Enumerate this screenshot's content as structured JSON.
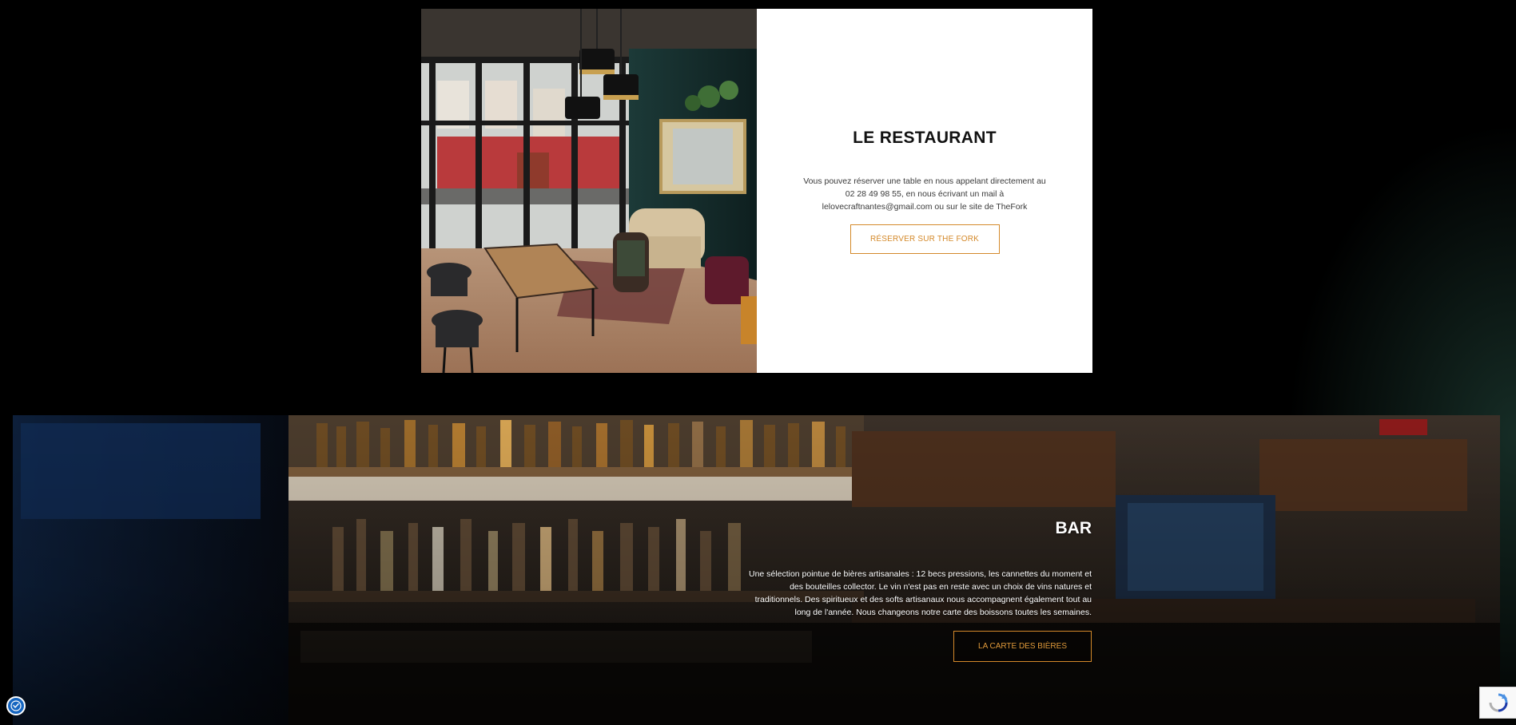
{
  "restaurant": {
    "title": "LE RESTAURANT",
    "description": "Vous pouvez réserver une table en nous appelant directement au 02 28 49 98 55, en nous écrivant un mail à lelovecraftnantes@gmail.com ou sur le site de TheFork",
    "button_label": "RÉSERVER SUR THE FORK"
  },
  "bar": {
    "title": "BAR",
    "description": "Une sélection pointue de bières artisanales : 12 becs pressions, les cannettes du moment et des bouteilles collector. Le vin n'est pas en reste avec un choix de vins natures et traditionnels. Des spiritueux et des softs artisanaux nous accompagnent également tout au long de l'année. Nous changeons notre carte des boissons toutes les semaines.",
    "button_label": "LA CARTE DES BIÈRES"
  },
  "widgets": {
    "accessibility_icon": "accessibility-icon",
    "recaptcha_icon": "recaptcha-icon"
  },
  "colors": {
    "accent": "#d4892a",
    "background": "#000000",
    "panel": "#ffffff"
  }
}
